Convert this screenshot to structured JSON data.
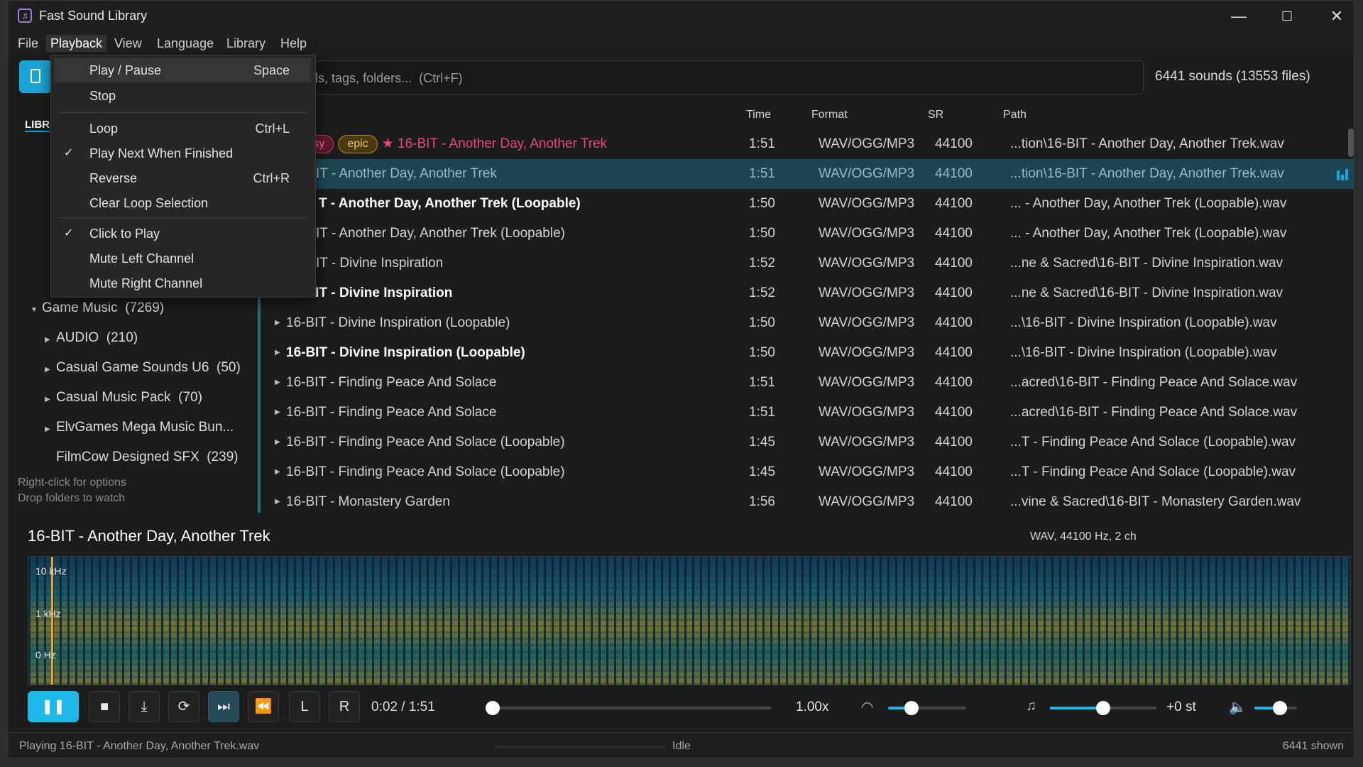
{
  "window": {
    "title": "Fast Sound Library"
  },
  "menu": [
    "File",
    "Playback",
    "View",
    "Language",
    "Library",
    "Help"
  ],
  "search": {
    "placeholder": "Search sounds, tags, folders...  (Ctrl+F)",
    "visible_placeholder": "h sounds, tags, folders...  (Ctrl+F)"
  },
  "sound_count": "6441 sounds (13553 files)",
  "sidebar": {
    "tab": "LIBR",
    "items": [
      {
        "label": "Game Music",
        "count": "(7269)",
        "expanded": true
      },
      {
        "label": "AUDIO",
        "count": "(210)"
      },
      {
        "label": "Casual Game Sounds U6",
        "count": "(50)"
      },
      {
        "label": "Casual Music Pack",
        "count": "(70)"
      },
      {
        "label": "ElvGames Mega Music Bun...",
        "count": ""
      },
      {
        "label": "FilmCow Designed SFX",
        "count": "(239)"
      }
    ],
    "hint1": "Right-click for options",
    "hint2": "Drop folders to watch"
  },
  "table": {
    "headers": {
      "time": "Time",
      "format": "Format",
      "sr": "SR",
      "path": "Path"
    },
    "rows": [
      {
        "name": "16-BIT - Another Day, Another Trek",
        "tags": [
          "tasy",
          "epic"
        ],
        "time": "1:51",
        "format": "WAV/OGG/MP3",
        "sr": "44100",
        "path": "...tion\\16-BIT - Another Day, Another Trek.wav"
      },
      {
        "name": "IT - Another Day, Another Trek",
        "time": "1:51",
        "format": "WAV/OGG/MP3",
        "sr": "44100",
        "path": "...tion\\16-BIT - Another Day, Another Trek.wav"
      },
      {
        "name": "T - Another Day, Another Trek (Loopable)",
        "time": "1:50",
        "format": "WAV/OGG/MP3",
        "sr": "44100",
        "path": "... - Another Day, Another Trek (Loopable).wav"
      },
      {
        "name": "IT - Another Day, Another Trek (Loopable)",
        "time": "1:50",
        "format": "WAV/OGG/MP3",
        "sr": "44100",
        "path": "... - Another Day, Another Trek (Loopable).wav"
      },
      {
        "name": "IT - Divine Inspiration",
        "time": "1:52",
        "format": "WAV/OGG/MP3",
        "sr": "44100",
        "path": "...ne & Sacred\\16-BIT - Divine Inspiration.wav"
      },
      {
        "name": "16-BIT - Divine Inspiration",
        "time": "1:52",
        "format": "WAV/OGG/MP3",
        "sr": "44100",
        "path": "...ne & Sacred\\16-BIT - Divine Inspiration.wav"
      },
      {
        "name": "16-BIT - Divine Inspiration (Loopable)",
        "time": "1:50",
        "format": "WAV/OGG/MP3",
        "sr": "44100",
        "path": "...\\16-BIT - Divine Inspiration (Loopable).wav"
      },
      {
        "name": "16-BIT - Divine Inspiration (Loopable)",
        "time": "1:50",
        "format": "WAV/OGG/MP3",
        "sr": "44100",
        "path": "...\\16-BIT - Divine Inspiration (Loopable).wav"
      },
      {
        "name": "16-BIT - Finding Peace And Solace",
        "time": "1:51",
        "format": "WAV/OGG/MP3",
        "sr": "44100",
        "path": "...acred\\16-BIT - Finding Peace And Solace.wav"
      },
      {
        "name": "16-BIT - Finding Peace And Solace",
        "time": "1:51",
        "format": "WAV/OGG/MP3",
        "sr": "44100",
        "path": "...acred\\16-BIT - Finding Peace And Solace.wav"
      },
      {
        "name": "16-BIT - Finding Peace And Solace (Loopable)",
        "time": "1:45",
        "format": "WAV/OGG/MP3",
        "sr": "44100",
        "path": "...T - Finding Peace And Solace (Loopable).wav"
      },
      {
        "name": "16-BIT - Finding Peace And Solace (Loopable)",
        "time": "1:45",
        "format": "WAV/OGG/MP3",
        "sr": "44100",
        "path": "...T - Finding Peace And Solace (Loopable).wav"
      },
      {
        "name": "16-BIT - Monastery Garden",
        "time": "1:56",
        "format": "WAV/OGG/MP3",
        "sr": "44100",
        "path": "...vine & Sacred\\16-BIT - Monastery Garden.wav"
      }
    ]
  },
  "playback_menu": {
    "items": [
      {
        "label": "Play / Pause",
        "shortcut": "Space",
        "checked": false
      },
      {
        "label": "Stop",
        "shortcut": "",
        "checked": false
      },
      {
        "label": "Loop",
        "shortcut": "Ctrl+L",
        "checked": false
      },
      {
        "label": "Play Next When Finished",
        "shortcut": "",
        "checked": true
      },
      {
        "label": "Reverse",
        "shortcut": "Ctrl+R",
        "checked": false
      },
      {
        "label": "Clear Loop Selection",
        "shortcut": "",
        "checked": false
      },
      {
        "label": "Click to Play",
        "shortcut": "",
        "checked": true
      },
      {
        "label": "Mute Left Channel",
        "shortcut": "",
        "checked": false
      },
      {
        "label": "Mute Right Channel",
        "shortcut": "",
        "checked": false
      }
    ]
  },
  "now_playing": {
    "title": "16-BIT - Another Day, Another Trek",
    "meta": "WAV, 44100 Hz, 2 ch",
    "freq_labels": [
      "10 kHz",
      "1 kHz",
      "0 Hz"
    ]
  },
  "transport": {
    "time": "0:02 / 1:51",
    "progress": 0.018,
    "rate": "1.00x",
    "rate_level": 0.3,
    "pitch": "+0 st",
    "pitch_level": 0.5,
    "volume_level": 0.6,
    "btn_L": "L",
    "btn_R": "R"
  },
  "status": {
    "text": "Playing 16-BIT - Another Day, Another Trek.wav",
    "state": "Idle",
    "shown": "6441 shown"
  },
  "colors": {
    "accent": "#1fb6e8",
    "playing": "#e8477e",
    "selected_row": "#1d4654"
  }
}
